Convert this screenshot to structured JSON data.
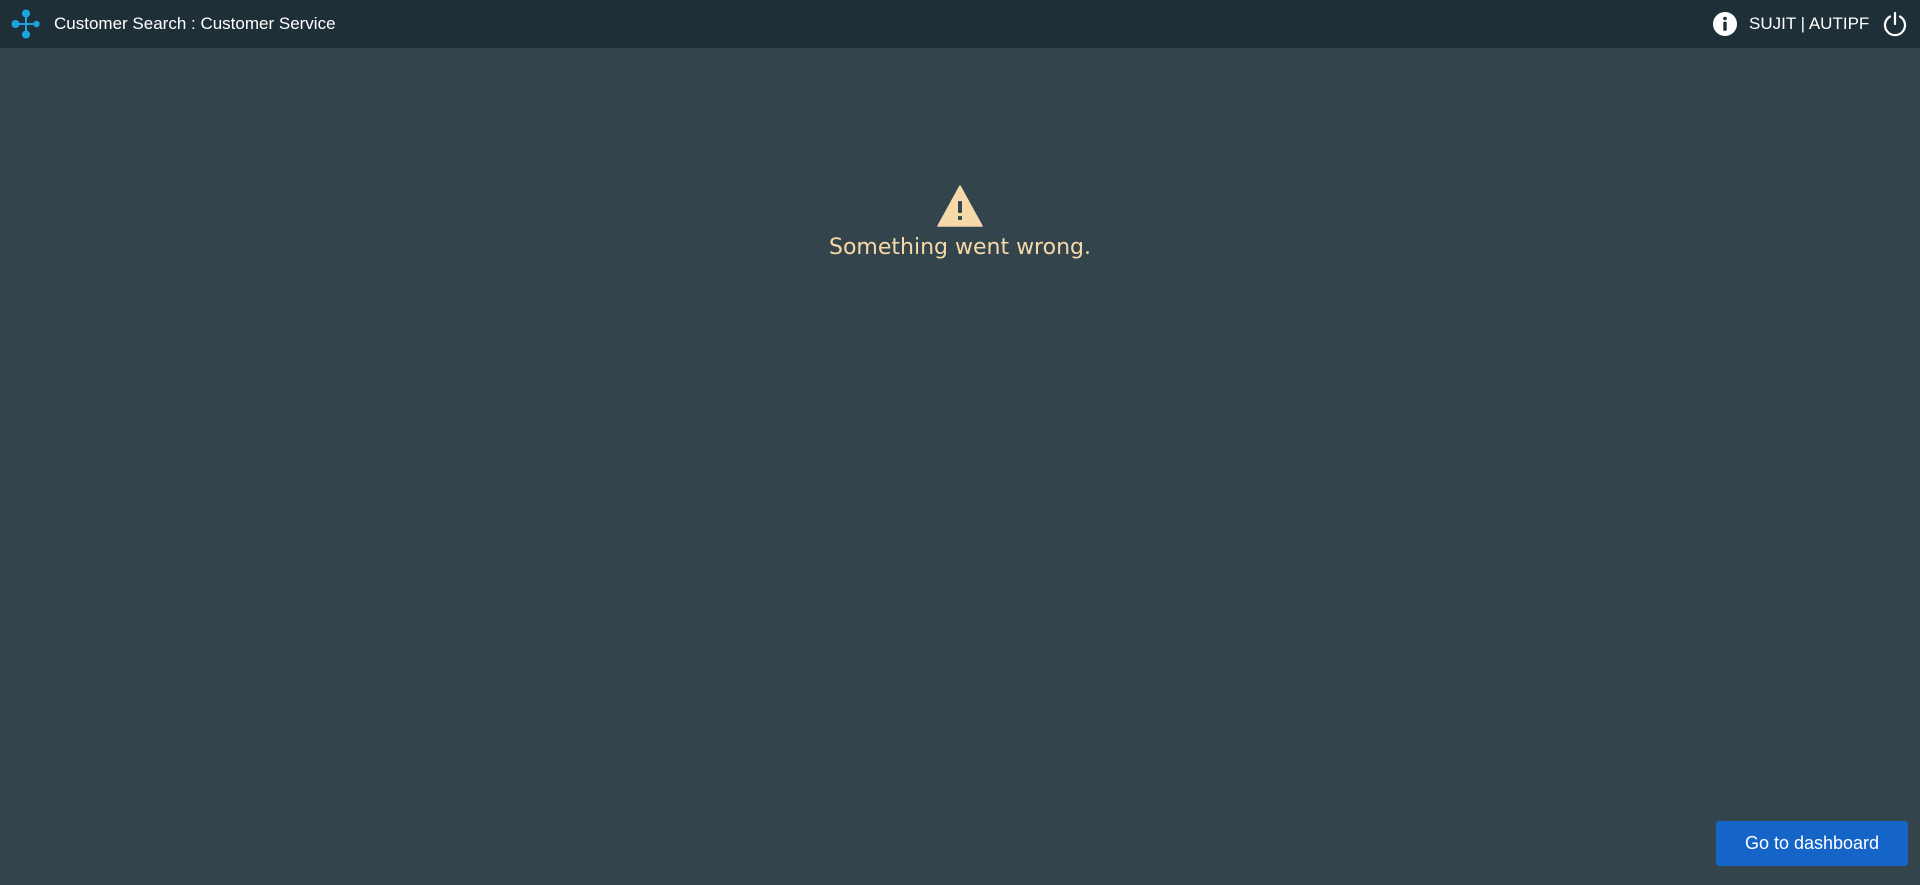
{
  "header": {
    "title": "Customer Search : Customer Service",
    "user": "SUJIT | AUTIPF",
    "logo_icon": "molecule-logo-icon",
    "info_icon": "info-icon",
    "power_icon": "power-icon"
  },
  "main": {
    "warning_icon": "warning-icon",
    "error_message": "Something went wrong."
  },
  "footer": {
    "dashboard_button_label": "Go to dashboard"
  },
  "colors": {
    "background": "#34444c",
    "header_background": "#1f2f38",
    "logo": "#1aa3e0",
    "warning": "#f6d9a8",
    "button": "#1565c8"
  }
}
